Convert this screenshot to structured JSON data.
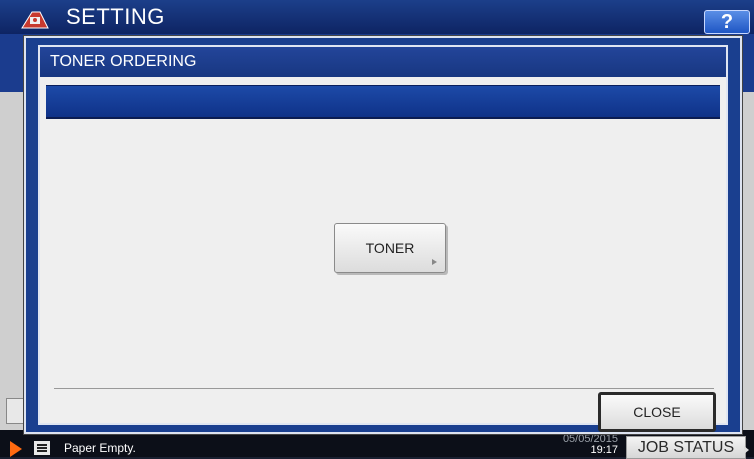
{
  "header": {
    "title": "SETTING",
    "help_label": "?"
  },
  "dialog": {
    "title": "TONER ORDERING",
    "toner_button_label": "TONER",
    "close_button_label": "CLOSE"
  },
  "status_bar": {
    "message": "Paper Empty.",
    "date": "05/05/2015",
    "time": "19:17",
    "job_status_label": "JOB STATUS"
  },
  "colors": {
    "header_blue": "#1c3f8a",
    "dialog_blue": "#1a3f8f",
    "status_arrow": "#ff6a10"
  },
  "icons": {
    "app": "setting-icon",
    "status_indicator": "arrow-right-icon",
    "status_list": "list-icon"
  }
}
